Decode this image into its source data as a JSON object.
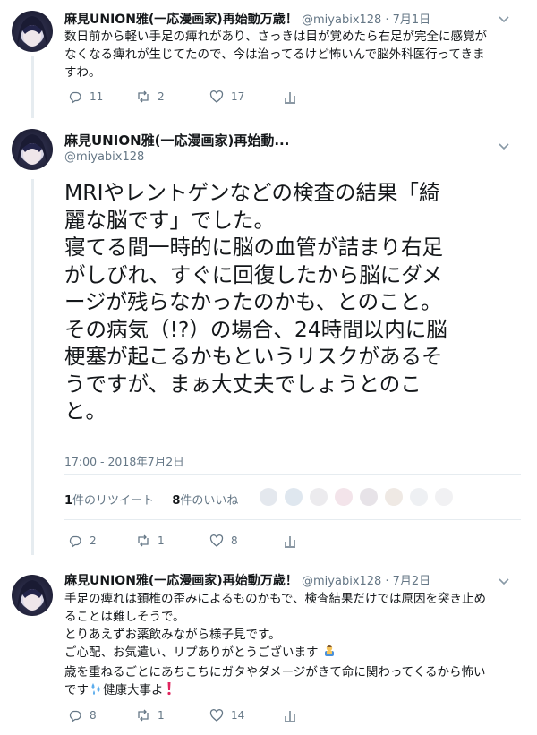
{
  "tweets": [
    {
      "name": "麻見UNION雅(一応漫画家)再始動万歳！",
      "handle": "@miyabix128",
      "time": "7月1日",
      "text": "数日前から軽い手足の痺れがあり、さっきは目が覚めたら右足が完全に感覚が\nなくなる痺れが生じてたので、今は治ってるけど怖いんで脳外科医行ってきま\nすわ。",
      "replies": "11",
      "retweets": "2",
      "likes": "17"
    },
    {
      "name": "麻見UNION雅(一応漫画家)再始動...",
      "handle": "@miyabix128",
      "text": "MRIやレントゲンなどの検査の結果「綺\n麗な脳です」でした。\n寝てる間一時的に脳の血管が詰まり右足\nがしびれ、すぐに回復したから脳にダメ\nージが残らなかったのかも、とのこと。\nその病気（!?）の場合、24時間以内に脳\n梗塞が起こるかもというリスクがあるそ\nうですが、まぁ大丈夫でしょうとのこ\nと。",
      "timestamp": "17:00 - 2018年7月2日",
      "retweet_count": "1",
      "retweet_label": "件のリツイート",
      "like_count": "8",
      "like_label": "件のいいね",
      "replies": "2",
      "retweets": "1",
      "likes": "8"
    },
    {
      "name": "麻見UNION雅(一応漫画家)再始動万歳！",
      "handle": "@miyabix128",
      "time": "7月2日",
      "text_lines": [
        "手足の痺れは頚椎の歪みによるものかもで、検査結果だけでは原因を突き止め",
        "ることは難しそうで。",
        "とりあえずお薬飲みながら様子見です。",
        "ご心配、お気遣い、リプありがとうございます",
        "歳を重ねるごとにあちこちにガタやダメージがきて命に関わってくるから怖い",
        "です",
        "健康大事よ"
      ],
      "replies": "8",
      "retweets": "1",
      "likes": "14"
    }
  ],
  "icons": [
    "reply-icon",
    "retweet-icon",
    "like-icon",
    "analytics-icon",
    "caret-down-icon"
  ],
  "colors": {
    "text": "#14171a",
    "secondary": "#657786",
    "thread_line": "#e6ecf0",
    "red_mark": "#e0245e"
  }
}
